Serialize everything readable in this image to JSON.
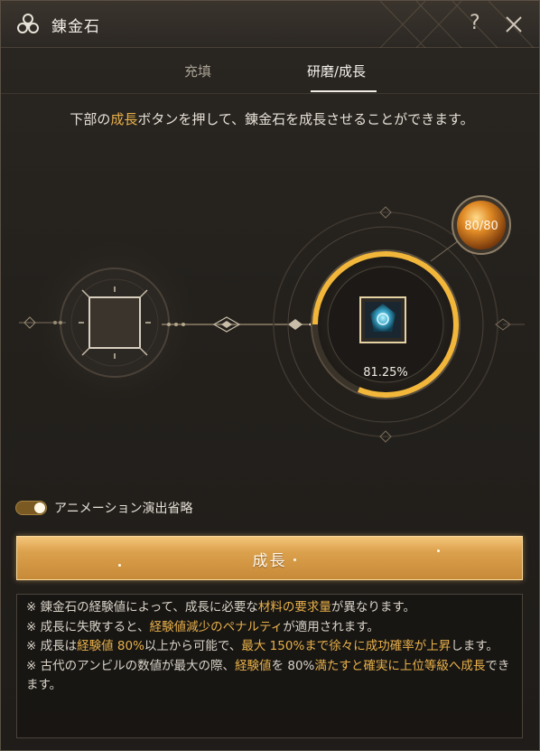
{
  "window": {
    "title": "錬金石",
    "help_label": "?"
  },
  "tabs": [
    {
      "label": "充填",
      "active": false
    },
    {
      "label": "研磨/成長",
      "active": true
    }
  ],
  "description": {
    "part1": "下部の",
    "highlight": "成長",
    "part2": "ボタンを押して、錬金石を成長させることができます。"
  },
  "stone": {
    "progress_text": "81.25%",
    "progress_value": 0.8125,
    "durability_text": "80/80"
  },
  "animation_toggle": {
    "label": "アニメーション演出省略",
    "on": true
  },
  "grow_button": {
    "label": "成長"
  },
  "notes": [
    [
      {
        "t": "※ 錬金石の経験値によって、成長に必要な"
      },
      {
        "t": "材料の要求量",
        "hl": true
      },
      {
        "t": "が異なります。"
      }
    ],
    [
      {
        "t": "※ 成長に失敗すると、"
      },
      {
        "t": "経験値減少のペナルティ",
        "hl": true
      },
      {
        "t": "が適用されます。"
      }
    ],
    [
      {
        "t": "※ 成長は"
      },
      {
        "t": "経験値 80%",
        "hl": true
      },
      {
        "t": "以上から可能で、"
      },
      {
        "t": "最大 150%まで徐々に成功確率が上昇",
        "hl": true
      },
      {
        "t": "します。"
      }
    ],
    [
      {
        "t": "※ 古代のアンビルの数値が最大の際、"
      },
      {
        "t": "経験値",
        "hl": true
      },
      {
        "t": "を 80%"
      },
      {
        "t": "満たすと確実に上位等級へ成長",
        "hl": true
      },
      {
        "t": "できます。"
      }
    ]
  ],
  "colors": {
    "accent_gold": "#e8b04a",
    "button_gold": "#dca14d",
    "panel_bg": "#24211d"
  },
  "icons": {
    "title_logo": "triskelion-icon",
    "close": "close-icon",
    "help": "help-icon",
    "stone": "alchemy-stone-icon"
  }
}
